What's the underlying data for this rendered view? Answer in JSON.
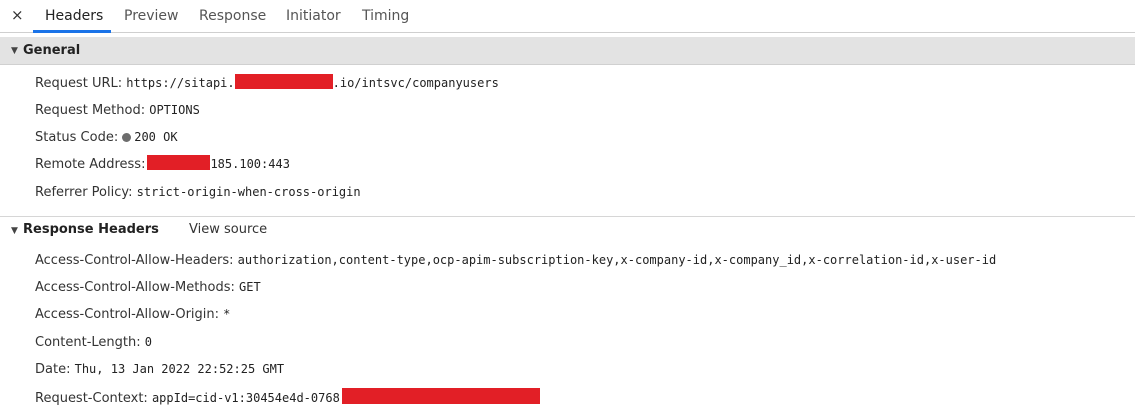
{
  "tabs": {
    "close_label": "×",
    "items": [
      "Headers",
      "Preview",
      "Response",
      "Initiator",
      "Timing"
    ],
    "active": "Headers",
    "accent_color": "#1a73e8"
  },
  "general": {
    "title": "General",
    "toggle_icon": "triangle-down",
    "request_url": {
      "key": "Request URL:",
      "value_prefix": "https://sitapi.",
      "value_suffix": ".io/intsvc/companyusers"
    },
    "request_method": {
      "key": "Request Method:",
      "value": "OPTIONS"
    },
    "status_code": {
      "key": "Status Code:",
      "value": "200 OK",
      "status_color": "#6d6d6d"
    },
    "remote_address": {
      "key": "Remote Address:",
      "value_suffix": "185.100:443"
    },
    "referrer_policy": {
      "key": "Referrer Policy:",
      "value": "strict-origin-when-cross-origin"
    }
  },
  "response_headers": {
    "title": "Response Headers",
    "toggle_icon": "triangle-down",
    "view_source_label": "View source",
    "rows": [
      {
        "key": "Access-Control-Allow-Headers:",
        "value": "authorization,content-type,ocp-apim-subscription-key,x-company-id,x-company_id,x-correlation-id,x-user-id"
      },
      {
        "key": "Access-Control-Allow-Methods:",
        "value": "GET"
      },
      {
        "key": "Access-Control-Allow-Origin:",
        "value": "*"
      },
      {
        "key": "Content-Length:",
        "value": "0"
      },
      {
        "key": "Date:",
        "value": "Thu, 13 Jan 2022 22:52:25 GMT"
      },
      {
        "key": "Request-Context:",
        "value": "appId=cid-v1:30454e4d-0768"
      }
    ]
  },
  "redaction_color": "#e21f26"
}
